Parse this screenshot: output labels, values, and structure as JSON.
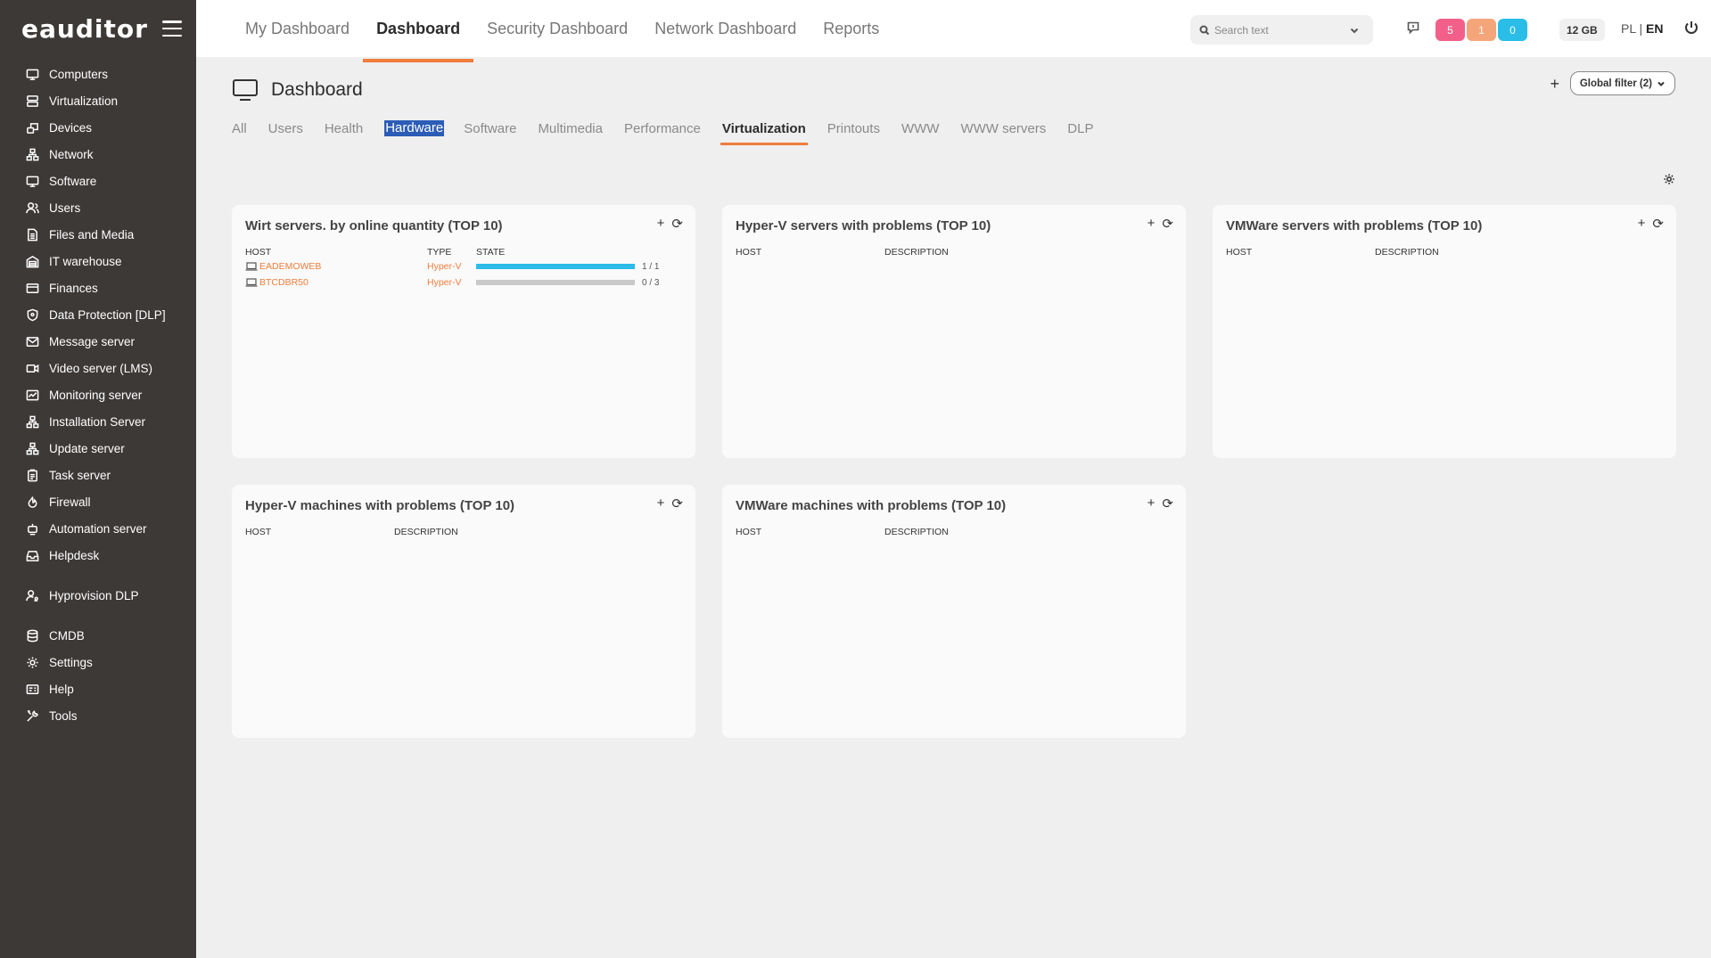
{
  "app": {
    "logo": "eauditor"
  },
  "sidebar": {
    "items": [
      {
        "label": "Computers",
        "icon": "monitor-icon"
      },
      {
        "label": "Virtualization",
        "icon": "server-icon"
      },
      {
        "label": "Devices",
        "icon": "devices-icon"
      },
      {
        "label": "Network",
        "icon": "network-icon"
      },
      {
        "label": "Software",
        "icon": "monitor-icon"
      },
      {
        "label": "Users",
        "icon": "users-icon"
      },
      {
        "label": "Files and Media",
        "icon": "file-icon"
      },
      {
        "label": "IT warehouse",
        "icon": "warehouse-icon"
      },
      {
        "label": "Finances",
        "icon": "card-icon"
      },
      {
        "label": "Data Protection [DLP]",
        "icon": "shield-icon"
      },
      {
        "label": "Message server",
        "icon": "mail-icon"
      },
      {
        "label": "Video server (LMS)",
        "icon": "video-icon"
      },
      {
        "label": "Monitoring server",
        "icon": "chart-icon"
      },
      {
        "label": "Installation Server",
        "icon": "network-icon"
      },
      {
        "label": "Update server",
        "icon": "network-icon"
      },
      {
        "label": "Task server",
        "icon": "clipboard-icon"
      },
      {
        "label": "Firewall",
        "icon": "fire-icon"
      },
      {
        "label": "Automation server",
        "icon": "robot-icon"
      },
      {
        "label": "Helpdesk",
        "icon": "inbox-icon"
      }
    ],
    "items2": [
      {
        "label": "Hyprovision DLP",
        "icon": "user-key-icon"
      }
    ],
    "items3": [
      {
        "label": "CMDB",
        "icon": "database-icon"
      },
      {
        "label": "Settings",
        "icon": "gear-icon"
      },
      {
        "label": "Help",
        "icon": "help-icon"
      },
      {
        "label": "Tools",
        "icon": "tools-icon"
      }
    ]
  },
  "topnav": {
    "tabs": [
      "My Dashboard",
      "Dashboard",
      "Security Dashboard",
      "Network Dashboard",
      "Reports"
    ],
    "active": "Dashboard",
    "search_placeholder": "Search text",
    "badges": [
      {
        "value": "5",
        "color": "#f2608a"
      },
      {
        "value": "1",
        "color": "#f5a57a"
      },
      {
        "value": "0",
        "color": "#29bde8"
      }
    ],
    "memory": "12 GB",
    "lang_pl": "PL",
    "lang_sep": " | ",
    "lang_en": "EN"
  },
  "page": {
    "title": "Dashboard",
    "add_label": "+",
    "global_filter": "Global filter (2)",
    "subtabs": [
      "All",
      "Users",
      "Health",
      "Hardware",
      "Software",
      "Multimedia",
      "Performance",
      "Virtualization",
      "Printouts",
      "WWW",
      "WWW servers",
      "DLP"
    ],
    "subtab_selected_text": "Hardware",
    "subtab_active": "Virtualization"
  },
  "cards": [
    {
      "title": "Wirt servers. by online quantity (TOP 10)",
      "columns": [
        "HOST",
        "TYPE",
        "STATE"
      ],
      "rows": [
        {
          "host": "EADEMOWEB",
          "type": "Hyper-V",
          "state": "1 / 1",
          "fill": 1.0
        },
        {
          "host": "BTCDBR50",
          "type": "Hyper-V",
          "state": "0 / 3",
          "fill": 0.0
        }
      ]
    },
    {
      "title": "Hyper-V servers with problems (TOP 10)",
      "columns": [
        "HOST",
        "DESCRIPTION"
      ]
    },
    {
      "title": "VMWare servers with problems (TOP 10)",
      "columns": [
        "HOST",
        "DESCRIPTION"
      ]
    },
    {
      "title": "Hyper-V machines with problems (TOP 10)",
      "columns": [
        "HOST",
        "DESCRIPTION"
      ]
    },
    {
      "title": "VMWare machines with problems (TOP 10)",
      "columns": [
        "HOST",
        "DESCRIPTION"
      ]
    }
  ],
  "card_actions": {
    "add": "+",
    "refresh": "⟳"
  }
}
